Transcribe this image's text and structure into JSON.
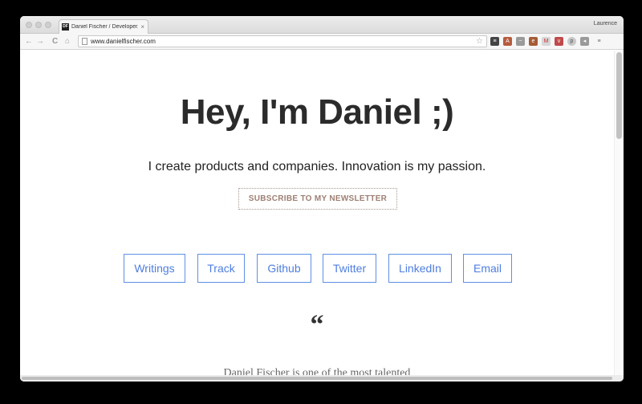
{
  "browser": {
    "tab_title": "Daniel Fischer / Developer, Designer",
    "favicon_text": "DF",
    "close_glyph": "×",
    "profile_name": "Laurence",
    "url": "www.danielfischer.com",
    "nav": {
      "back": "←",
      "forward": "→",
      "reload": "C",
      "home": "⌂"
    },
    "star_glyph": "☆",
    "extensions": [
      {
        "icon": "buffer-icon",
        "color": "#444444",
        "glyph": "≡"
      },
      {
        "icon": "translate-icon",
        "color": "#b55b3e",
        "glyph": "A"
      },
      {
        "icon": "chart-icon",
        "color": "#9a9a9a",
        "glyph": "~"
      },
      {
        "icon": "evernote-icon",
        "color": "#a65c34",
        "glyph": "e"
      },
      {
        "icon": "gmail-icon",
        "color": "#d7d7d7",
        "glyph": "M"
      },
      {
        "icon": "pocket-icon",
        "color": "#c04a4a",
        "glyph": "v"
      },
      {
        "icon": "pinterest-icon",
        "color": "#c9c9c9",
        "glyph": "p"
      },
      {
        "icon": "sound-icon",
        "color": "#9a9a9a",
        "glyph": "◂"
      },
      {
        "icon": "menu-icon",
        "color": "#9a9a9a",
        "glyph": "≡"
      }
    ]
  },
  "page": {
    "title": "Hey, I'm Daniel ;)",
    "tagline": "I create products and companies. Innovation is my passion.",
    "subscribe_label": "SUBSCRIBE TO MY NEWSLETTER",
    "links": [
      {
        "label": "Writings"
      },
      {
        "label": "Track"
      },
      {
        "label": "Github"
      },
      {
        "label": "Twitter"
      },
      {
        "label": "LinkedIn"
      },
      {
        "label": "Email"
      }
    ],
    "quote_glyph": "“",
    "quote_text_partial": "Daniel Fischer is one of the most talented"
  }
}
